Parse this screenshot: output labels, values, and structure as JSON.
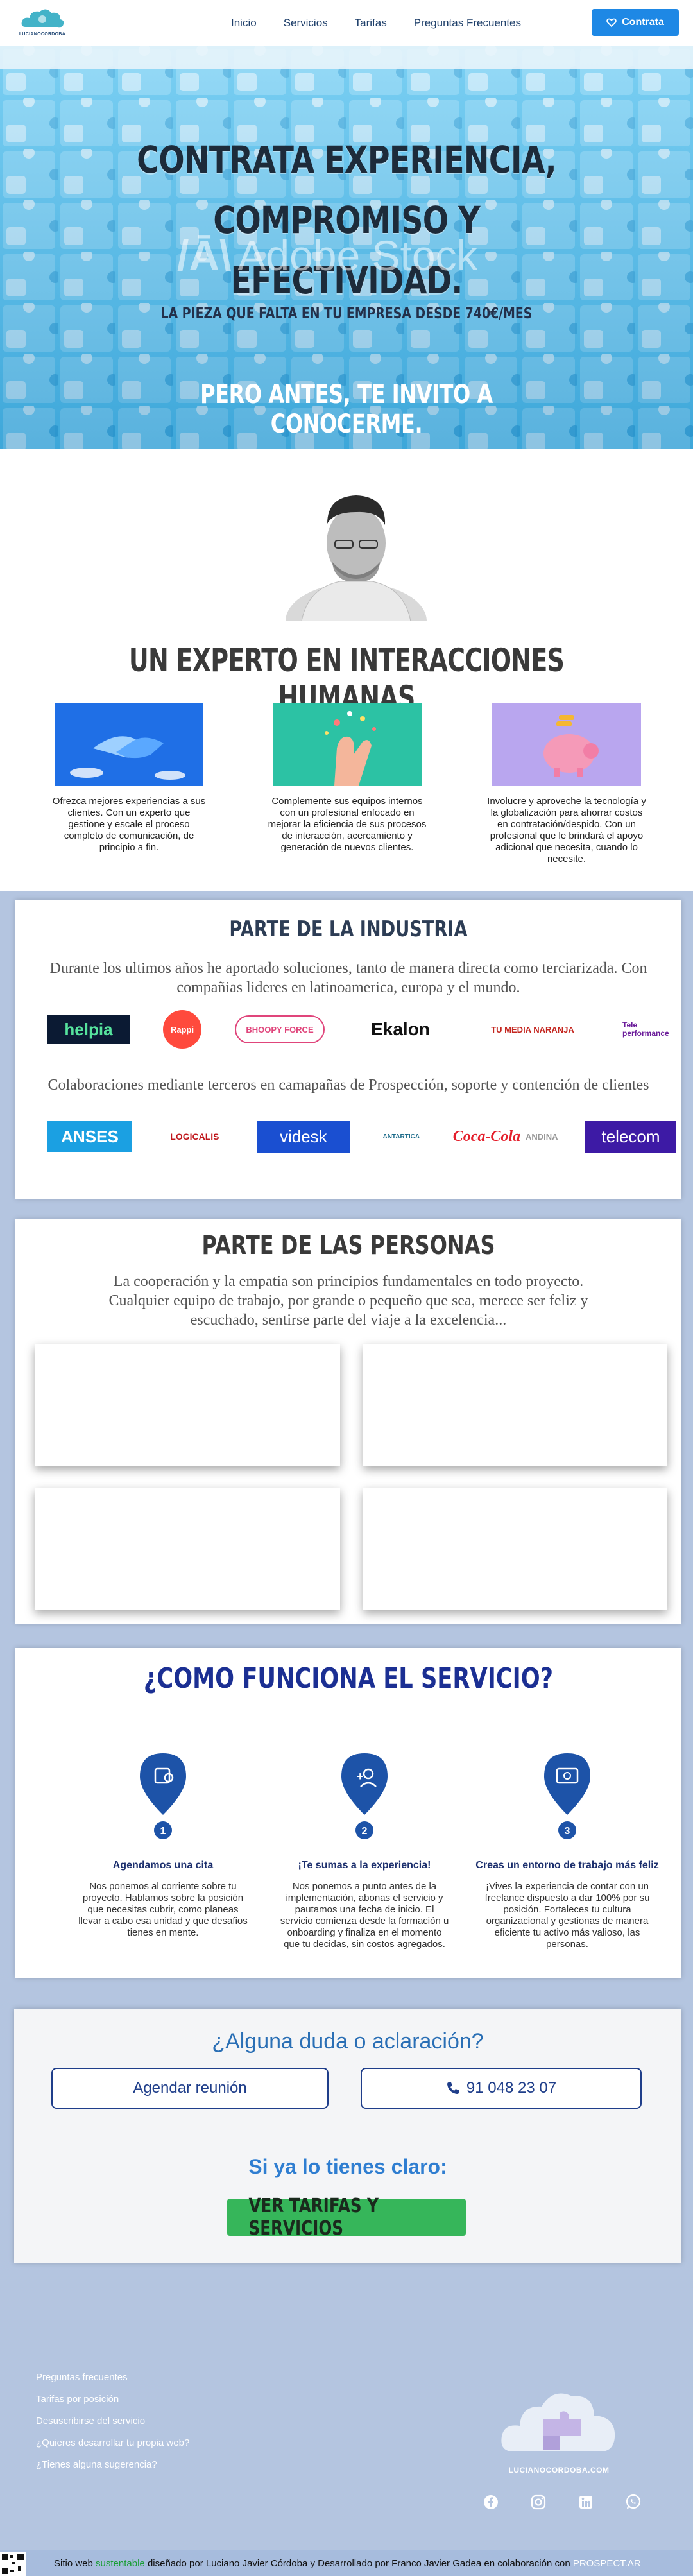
{
  "header": {
    "logo_text": "LUCIANOCORDOBA",
    "nav": [
      "Inicio",
      "Servicios",
      "Tarifas",
      "Preguntas Frecuentes"
    ],
    "cta": "Contrata"
  },
  "hero": {
    "title_line1": "CONTRATA EXPERIENCIA, COMPROMISO Y",
    "title_line2": "EFECTIVIDAD.",
    "watermark": "Adobe Stock",
    "subtitle": "LA PIEZA QUE FALTA EN TU EMPRESA DESDE 740€/MES",
    "cta": "PERO ANTES, TE INVITO A CONOCERME."
  },
  "about": {
    "title": "UN EXPERTO EN INTERACCIONES HUMANAS",
    "features": [
      {
        "text": "Ofrezca mejores experiencias a sus clientes. Con un experto que gestione y escale el proceso completo de comunicación, de principio a fin."
      },
      {
        "text": "Complemente sus equipos internos con un profesional enfocado en mejorar la eficiencia de sus procesos de interacción, acercamiento y generación de nuevos clientes."
      },
      {
        "text": "Involucre y aproveche la tecnología y la globalización para ahorrar costos en contratación/despido. Con un profesional que le brindará el apoyo adicional que necesita, cuando lo necesite."
      }
    ]
  },
  "industry": {
    "title": "PARTE DE LA INDUSTRIA",
    "intro": "Durante los ultimos años he aportado soluciones, tanto de manera directa como terciarizada. Con compañias lideres en latinoamerica, europa y el mundo.",
    "row1": [
      "helpia",
      "Rappi",
      "BHOOPY FORCE",
      "Ekalon",
      "TU MEDIA NARANJA",
      "Tele performance"
    ],
    "collab": "Colaboraciones mediante terceros en camapañas de Prospección, soporte y contención de clientes",
    "row2": [
      "ANSES",
      "LOGICALIS",
      "videsk",
      "ANTARTICA",
      "Coca-Cola",
      "ANDINA",
      "telecom"
    ]
  },
  "people": {
    "title": "PARTE DE LAS PERSONAS",
    "text_line1": "La cooperación y la empatia son principios fundamentales en todo proyecto.",
    "text_line2": "Cualquier equipo de trabajo, por grande o pequeño que sea, merece ser feliz y",
    "text_line3": "escuchado, sentirse parte del viaje a la excelencia..."
  },
  "how": {
    "title": "¿COMO FUNCIONA EL SERVICIO?",
    "steps": [
      {
        "num": "1",
        "title": "Agendamos una cita",
        "text": "Nos ponemos al corriente sobre tu proyecto. Hablamos sobre la posición que necesitas cubrir, como planeas llevar a cabo esa unidad y que desafios tienes en mente."
      },
      {
        "num": "2",
        "title": "¡Te sumas a la experiencia!",
        "text": "Nos ponemos a punto antes de la implementación, abonas el servicio y pautamos una fecha de inicio. El servicio comienza desde la formación u onboarding y finaliza en el momento que tu decidas, sin costos agregados."
      },
      {
        "num": "3",
        "title": "Creas un entorno de trabajo más feliz",
        "text": "¡Vives la experiencia de contar con un freelance dispuesto a dar 100% por su posición. Fortaleces tu cultura organizacional y gestionas de manera eficiente tu activo más valioso, las personas."
      }
    ]
  },
  "contact": {
    "question": "¿Alguna duda o aclaración?",
    "schedule": "Agendar reunión",
    "phone": "91 048 23 07",
    "clear": "Si ya lo tienes claro:",
    "cta": "VER TARIFAS Y SERVICIOS"
  },
  "footer": {
    "links": [
      "Preguntas frecuentes",
      "Tarifas por posición",
      "Desuscribirse del servicio",
      "¿Quieres desarrollar tu propia web?",
      "¿Tienes alguna sugerencia?"
    ],
    "logo_text": "LUCIANOCORDOBA.COM",
    "credit_pre": "Sitio web",
    "credit_green": "sustentable",
    "credit_mid": "diseñado por Luciano Javier Córdoba y Desarrollado por Franco Javier Gadea en colaboración con",
    "credit_brand": "PROSPECT.AR"
  },
  "colors": {
    "brand_blue": "#1e88e5",
    "dark_blue": "#1c2f6d",
    "green": "#36b65a",
    "background": "#b4c5e0"
  }
}
